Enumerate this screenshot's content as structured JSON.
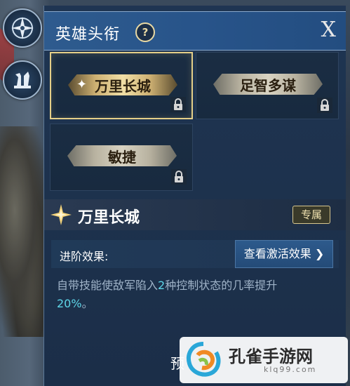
{
  "header": {
    "title": "英雄头衔",
    "help_symbol": "?",
    "close_label": "X"
  },
  "titles": [
    {
      "label": "万里长城",
      "selected": true,
      "locked": true
    },
    {
      "label": "足智多谋",
      "selected": false,
      "locked": true
    },
    {
      "label": "敏捷",
      "selected": false,
      "locked": true
    }
  ],
  "detail": {
    "name": "万里长城",
    "tag": "专属",
    "effect_label": "进阶效果:",
    "view_button": "查看激活效果",
    "desc_pre": "自带技能使敌军陷入",
    "desc_num": "2",
    "desc_mid": "种控制状态的几率提升",
    "desc_pct": "20%",
    "desc_end": "。"
  },
  "footer": {
    "partial_text": "预"
  },
  "watermark": {
    "name": "孔雀手游网",
    "url": "klq99.com"
  },
  "icons": {
    "side_top": "compass-emblem-icon",
    "side_second": "chess-pieces-icon",
    "star": "sparkle-star-icon",
    "lock": "lock-icon"
  },
  "colors": {
    "accent_gold": "#e5cf88",
    "highlight_cyan": "#5ed6e8",
    "header_blue": "#2e5b8e"
  }
}
